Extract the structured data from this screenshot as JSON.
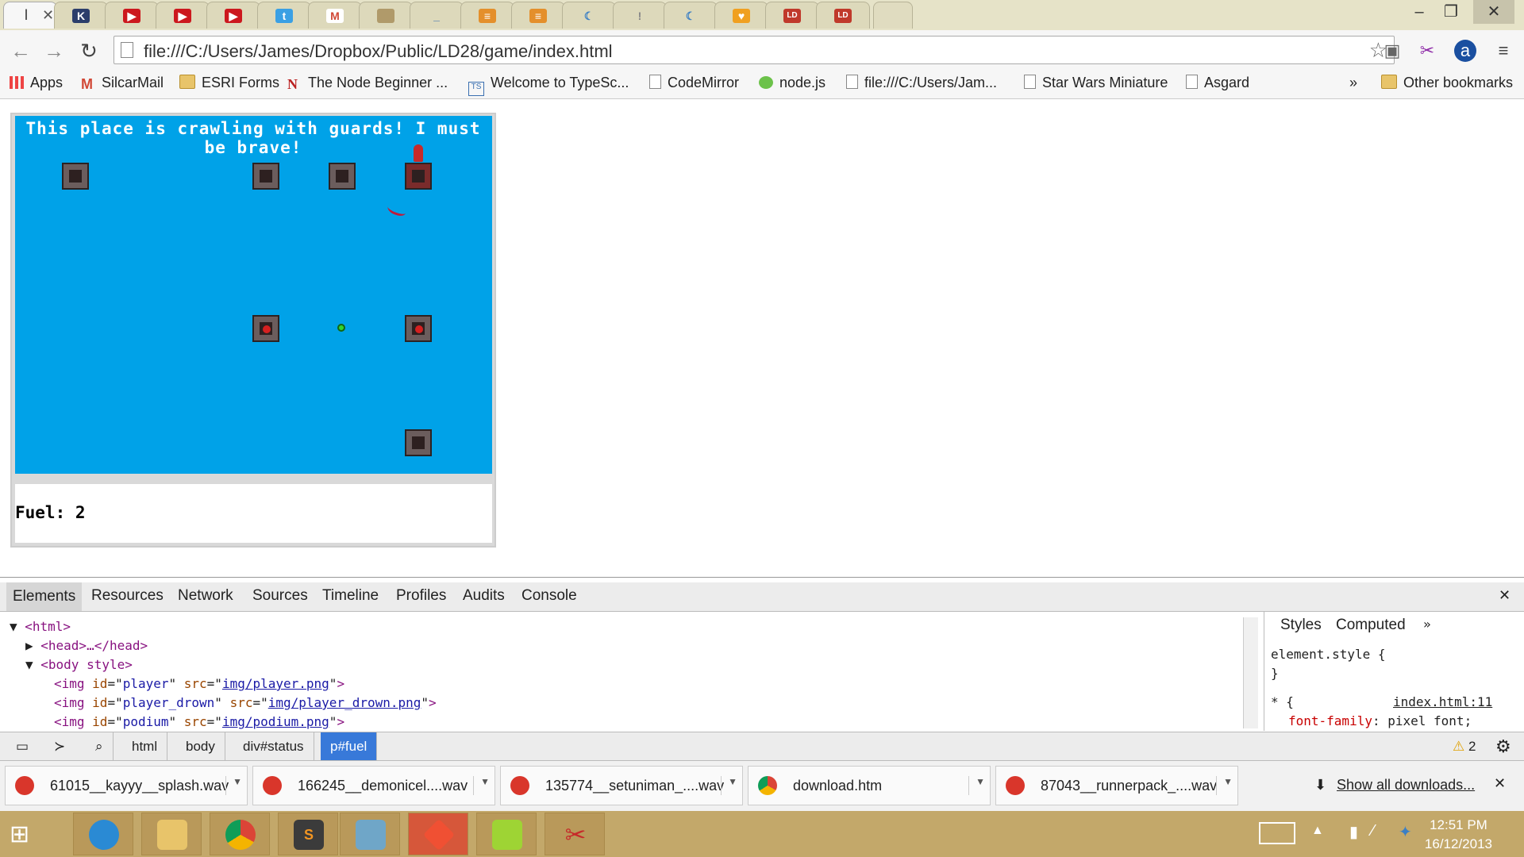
{
  "browser": {
    "active_tab_label": "l",
    "tabs": [
      {
        "icon": "tab-favicon-active",
        "color": "#888888"
      },
      {
        "icon": "kongregate-icon",
        "color": "#2c3e6b"
      },
      {
        "icon": "youtube-icon",
        "color": "#cc181e"
      },
      {
        "icon": "youtube-icon",
        "color": "#cc181e"
      },
      {
        "icon": "youtube-icon",
        "color": "#cc181e"
      },
      {
        "icon": "twitter-icon",
        "color": "#3aa0e4"
      },
      {
        "icon": "gmail-icon",
        "color": "#d14836"
      },
      {
        "icon": "document-icon",
        "color": "#b09a6a"
      },
      {
        "icon": "underscore-icon",
        "color": "#3a6fb0"
      },
      {
        "icon": "stackoverflow-icon",
        "color": "#e48f2b"
      },
      {
        "icon": "stackoverflow-icon",
        "color": "#e48f2b"
      },
      {
        "icon": "moon-icon",
        "color": "#3b7fc4"
      },
      {
        "icon": "blank-icon",
        "color": "#999999"
      },
      {
        "icon": "moon-icon",
        "color": "#3b7fc4"
      },
      {
        "icon": "shield-icon",
        "color": "#f0a020"
      },
      {
        "icon": "ld48-icon",
        "color": "#c0392b"
      },
      {
        "icon": "ld48-icon",
        "color": "#c0392b"
      }
    ],
    "address": "file:///C:/Users/James/Dropbox/Public/LD28/game/index.html",
    "bookmarks": [
      {
        "label": "Apps",
        "icon": "apps-grid-icon"
      },
      {
        "label": "SilcarMail",
        "icon": "gmail-icon"
      },
      {
        "label": "ESRI Forms",
        "icon": "folder-icon"
      },
      {
        "label": "The Node Beginner ...",
        "icon": "n-logo-icon"
      },
      {
        "label": "Welcome to TypeSc...",
        "icon": "typescript-icon"
      },
      {
        "label": "CodeMirror",
        "icon": "page-icon"
      },
      {
        "label": "node.js",
        "icon": "nodejs-icon"
      },
      {
        "label": "file:///C:/Users/Jam...",
        "icon": "page-icon"
      },
      {
        "label": "Star Wars Miniature",
        "icon": "page-icon"
      },
      {
        "label": "Asgard",
        "icon": "page-icon"
      }
    ],
    "bookmarks_overflow": "»",
    "other_bookmarks": "Other bookmarks"
  },
  "game": {
    "message": "This place is crawling with guards! I must be brave!",
    "fuel_label": "Fuel: 2"
  },
  "devtools": {
    "tabs": [
      "Elements",
      "Resources",
      "Network",
      "Sources",
      "Timeline",
      "Profiles",
      "Audits",
      "Console"
    ],
    "dom": {
      "html": "<html>",
      "head": "<head>…</head>",
      "body": "<body style>",
      "img1_id": "player",
      "img1_src": "img/player.png",
      "img2_id": "player_drown",
      "img2_src": "img/player_drown.png",
      "img3_id": "podium",
      "img3_src": "img/podium.png"
    },
    "styles_tabs": [
      "Styles",
      "Computed"
    ],
    "styles_more": "»",
    "element_style": "element.style {",
    "close_brace": "}",
    "rule_selector": "* {",
    "rule_source": "index.html:11",
    "rule_prop": "font-family",
    "rule_value": "pixel font;",
    "breadcrumbs": [
      "html",
      "body",
      "div#status",
      "p#fuel"
    ],
    "warnings": "2"
  },
  "downloads": {
    "items": [
      "61015__kayyy__splash.wav",
      "166245__demonicel....wav",
      "135774__setuniman_....wav",
      "download.htm",
      "87043__runnerpack_....wav"
    ],
    "show_all": "Show all downloads..."
  },
  "taskbar": {
    "time": "12:51 PM",
    "date": "16/12/2013"
  }
}
